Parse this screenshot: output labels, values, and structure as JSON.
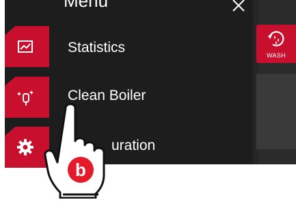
{
  "menu": {
    "title": "Menu",
    "items": [
      {
        "label": "Statistics",
        "icon": "chart-icon"
      },
      {
        "label": "Clean Boiler",
        "icon": "sparkle-boiler-icon"
      },
      {
        "label": "Configuration",
        "visible_label": "uration",
        "icon": "gear-icon"
      }
    ]
  },
  "side": {
    "wash_label": "WASH"
  },
  "overlay": {
    "badge_letter": "b"
  },
  "colors": {
    "accent": "#c8102e",
    "panel": "#1d1d1d",
    "text": "#ffffff"
  }
}
